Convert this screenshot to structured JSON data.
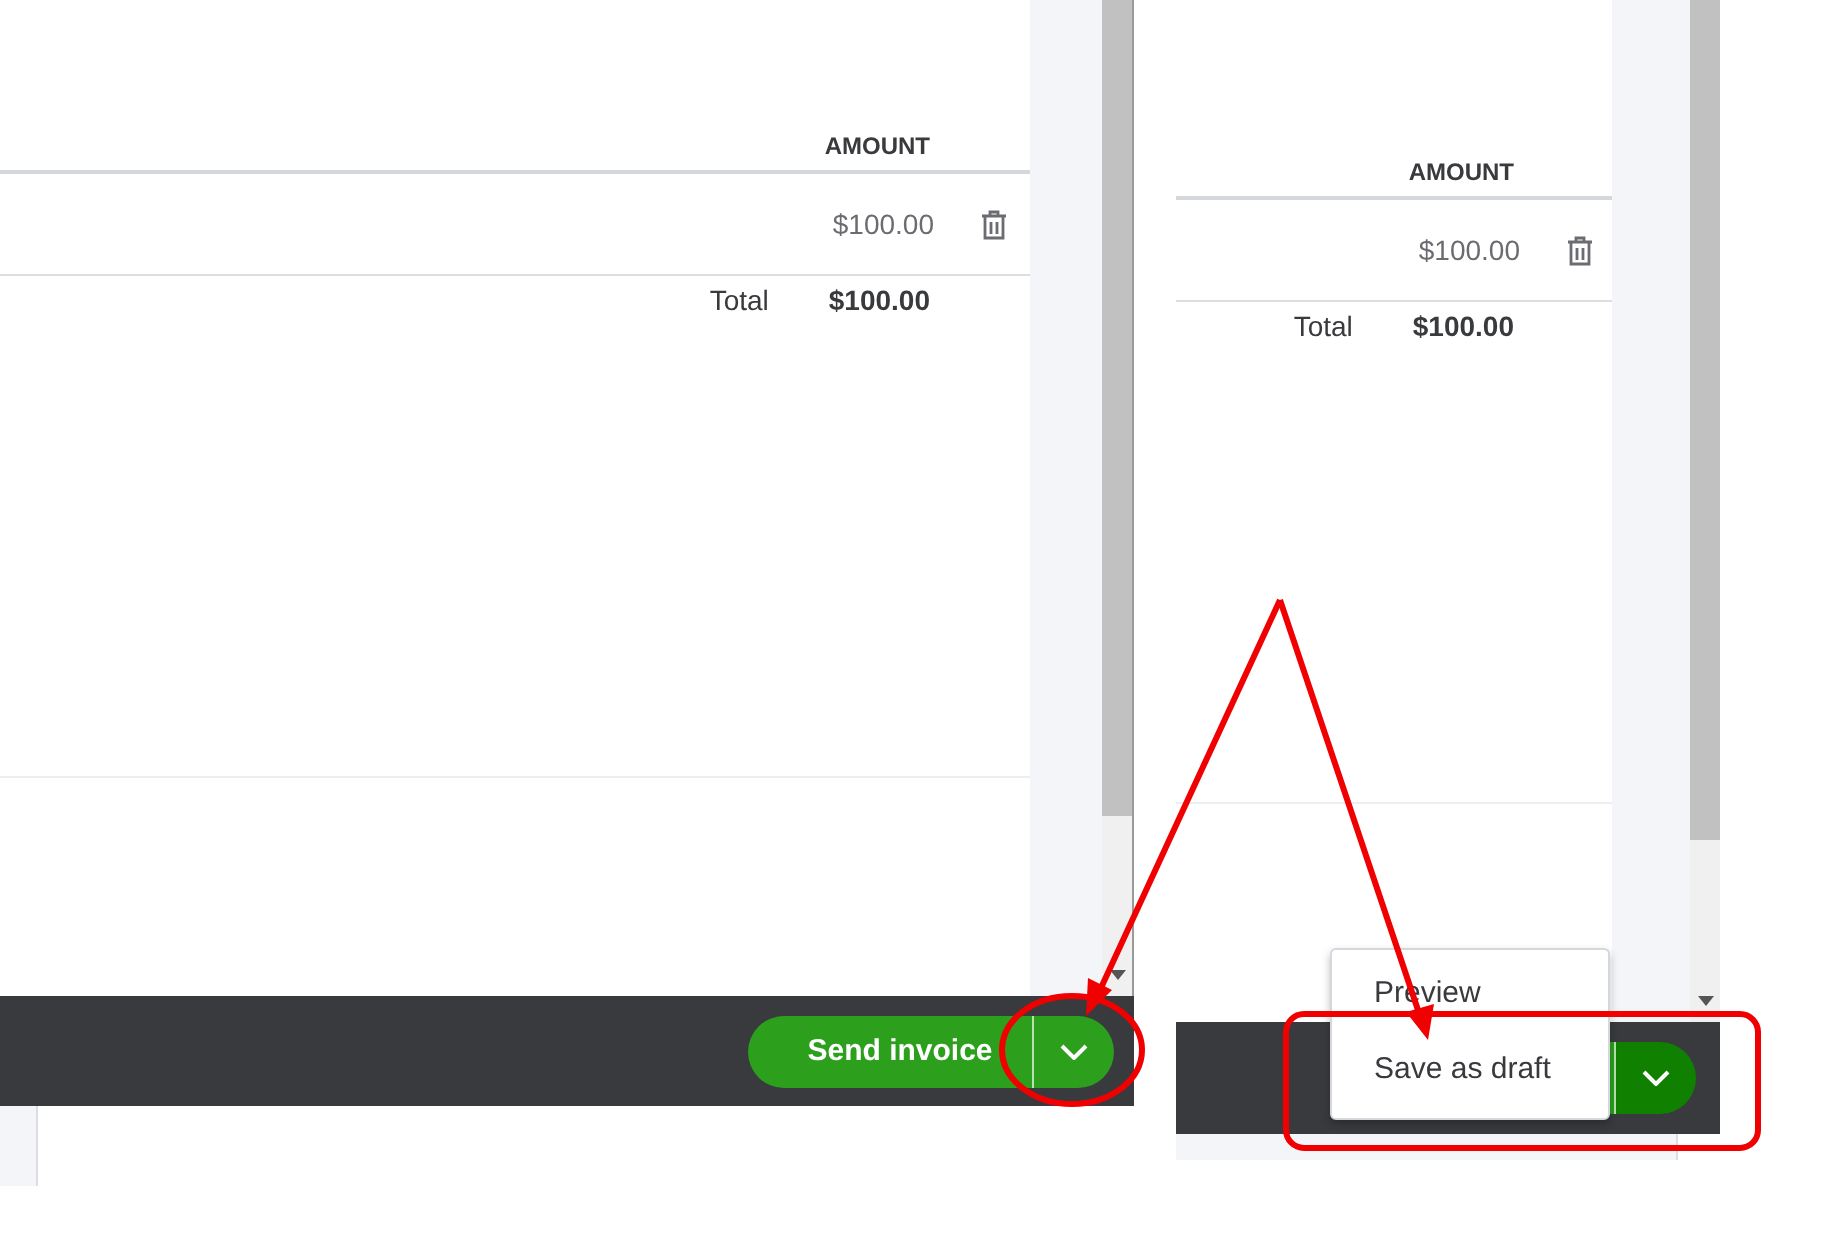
{
  "panels": [
    {
      "table": {
        "columns": [
          {
            "label": "AMOUNT"
          }
        ],
        "rows": [
          {
            "amount": "$100.00"
          }
        ],
        "total_label": "Total",
        "total_value": "$100.00"
      },
      "footer": {
        "primary_label": "Send invoice",
        "menu_open": false
      }
    },
    {
      "table": {
        "columns": [
          {
            "label": "AMOUNT"
          }
        ],
        "rows": [
          {
            "amount": "$100.00"
          }
        ],
        "total_label": "Total",
        "total_value": "$100.00"
      },
      "footer": {
        "menu_open": true,
        "menu_items": [
          {
            "label": "Preview"
          },
          {
            "label": "Save as draft"
          }
        ]
      }
    }
  ]
}
